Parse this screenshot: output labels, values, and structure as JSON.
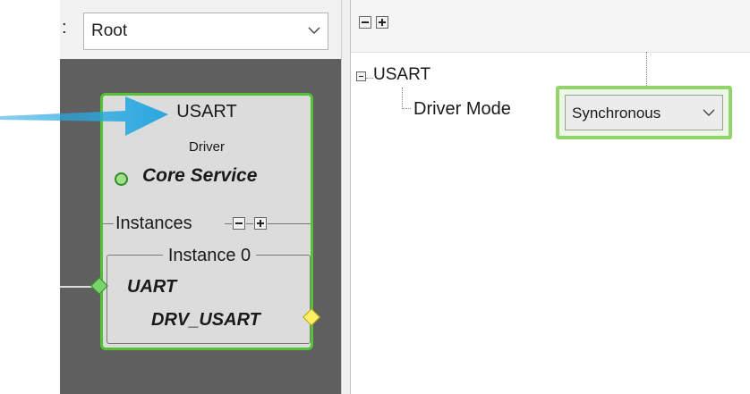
{
  "toolbar_left": {
    "separator": ":",
    "select_value": "Root"
  },
  "component": {
    "title": "USART",
    "subtitle": "Driver",
    "capability": "Core Service",
    "instances_label": "Instances",
    "instance_name": "Instance 0",
    "input_port": "UART",
    "output_port": "DRV_USART"
  },
  "tree": {
    "root_label": "USART",
    "child_label": "Driver Mode",
    "child_value": "Synchronous"
  },
  "colors": {
    "highlight": "#93d36c",
    "card_border": "#55c232",
    "arrow": "#29a8e0"
  },
  "icons": [
    "chevron-down-icon",
    "collapse-all-icon",
    "expand-all-icon",
    "tree-collapse-icon",
    "pointer-arrow-icon"
  ]
}
